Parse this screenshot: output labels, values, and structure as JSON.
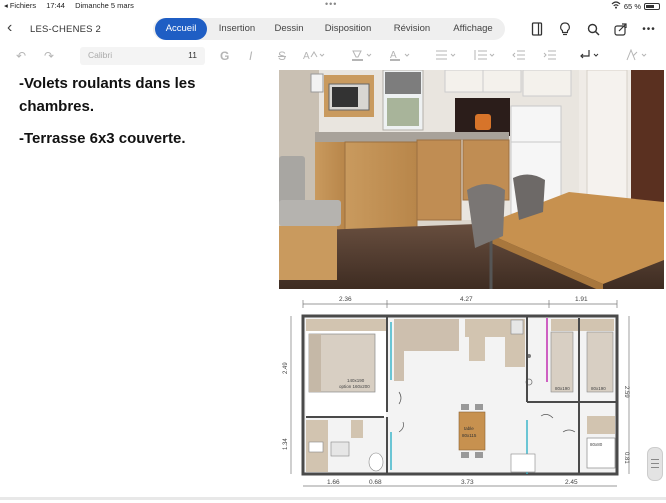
{
  "status_bar": {
    "app": "◂ Fichiers",
    "time": "17:44",
    "date": "Dimanche 5 mars",
    "dots": "•••",
    "battery": "65 %",
    "battery_fraction": 0.65
  },
  "toolbar": {
    "back_icon": "chevron-left-icon",
    "doc_title": "LES-CHENES 2",
    "tabs": [
      {
        "label": "Accueil",
        "active": true
      },
      {
        "label": "Insertion",
        "active": false
      },
      {
        "label": "Dessin",
        "active": false
      },
      {
        "label": "Disposition",
        "active": false
      },
      {
        "label": "Révision",
        "active": false
      },
      {
        "label": "Affichage",
        "active": false
      }
    ],
    "icons": [
      "page-icon",
      "lightbulb-icon",
      "search-icon",
      "share-icon",
      "more-icon"
    ],
    "more_label": "•••"
  },
  "format_bar": {
    "font_name": "Calibri",
    "font_size": "11",
    "bold": "G",
    "italic": "I",
    "strike": "S"
  },
  "content": {
    "line1": "-Volets roulants dans les",
    "line2": "chambres.",
    "line3": "-Terrasse 6x3 couverte."
  },
  "floor_plan": {
    "dims_top": [
      "2.36",
      "4.27",
      "1.91"
    ],
    "dims_bottom": [
      "1.66",
      "0.68",
      "3.73",
      "2.45"
    ],
    "dims_left": [
      "2.49",
      "1.34"
    ],
    "dims_right": [
      "2.59",
      "0.81"
    ],
    "labels": {
      "bed_main_1": "140x190",
      "bed_main_2": "option 160x200",
      "bed_a": "80x190",
      "bed_b": "80x190",
      "table_1": "table",
      "table_2": "80x115",
      "shower": "80x80"
    }
  },
  "colors": {
    "accent": "#1f5ec4"
  }
}
